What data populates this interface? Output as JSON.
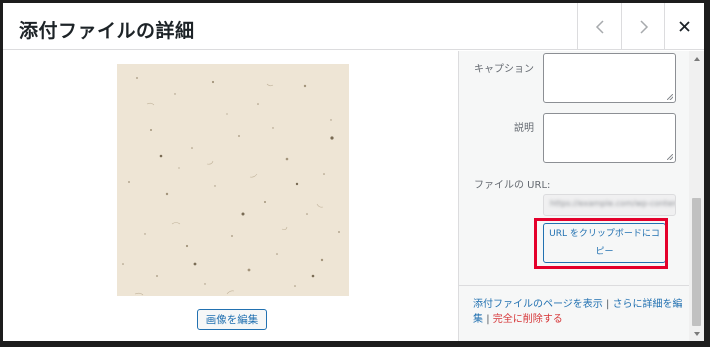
{
  "header": {
    "title": "添付ファイルの詳細"
  },
  "preview": {
    "edit_label": "画像を編集"
  },
  "details": {
    "caption_label": "キャプション",
    "description_label": "説明",
    "url_label": "ファイルの URL:",
    "url_value": "https://example.com/wp-content/uploads/paper.jpg",
    "copy_label": "URL をクリップボードにコピー"
  },
  "actions": {
    "view_page": "添付ファイルのページを表示",
    "separator": "|",
    "more_details": "さらに詳細を編集",
    "delete": "完全に削除する"
  },
  "colors": {
    "accent": "#2271b1",
    "danger": "#d63638",
    "highlight": "#e4002b"
  }
}
